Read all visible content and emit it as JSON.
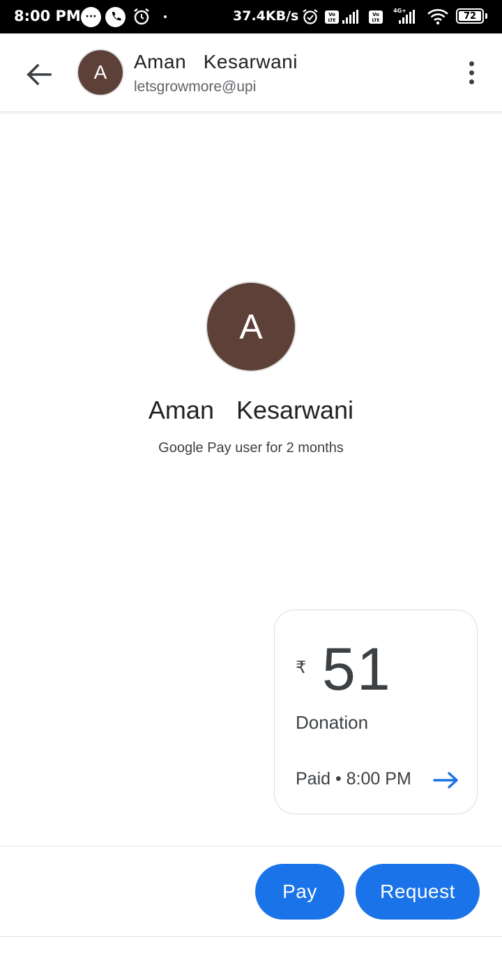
{
  "status_bar": {
    "time": "8:00 PM",
    "net_speed": "37.4KB/s",
    "battery": "72",
    "network_type": "4G+",
    "icons": [
      "chat-bubble-icon",
      "phone-call-icon",
      "alarm-icon",
      "alarm-clock-icon",
      "volte-icon",
      "signal-icon",
      "wifi-icon",
      "battery-icon"
    ]
  },
  "header": {
    "avatar_initial": "A",
    "contact_name": "Aman  Kesarwani",
    "upi_id": "letsgrowmore@upi",
    "back_icon": "back-arrow-icon",
    "menu_icon": "more-vert-icon"
  },
  "profile": {
    "avatar_initial": "A",
    "name": "Aman  Kesarwani",
    "subtitle": "Google Pay user for 2 months"
  },
  "transaction": {
    "currency_symbol": "₹",
    "amount": "51",
    "note": "Donation",
    "status": "Paid • 8:00 PM",
    "details_icon": "arrow-right-icon"
  },
  "actions": {
    "pay_label": "Pay",
    "request_label": "Request"
  },
  "colors": {
    "accent": "#1a73e8",
    "avatar_bg": "#5d4037",
    "status_bar_bg": "#000000"
  }
}
